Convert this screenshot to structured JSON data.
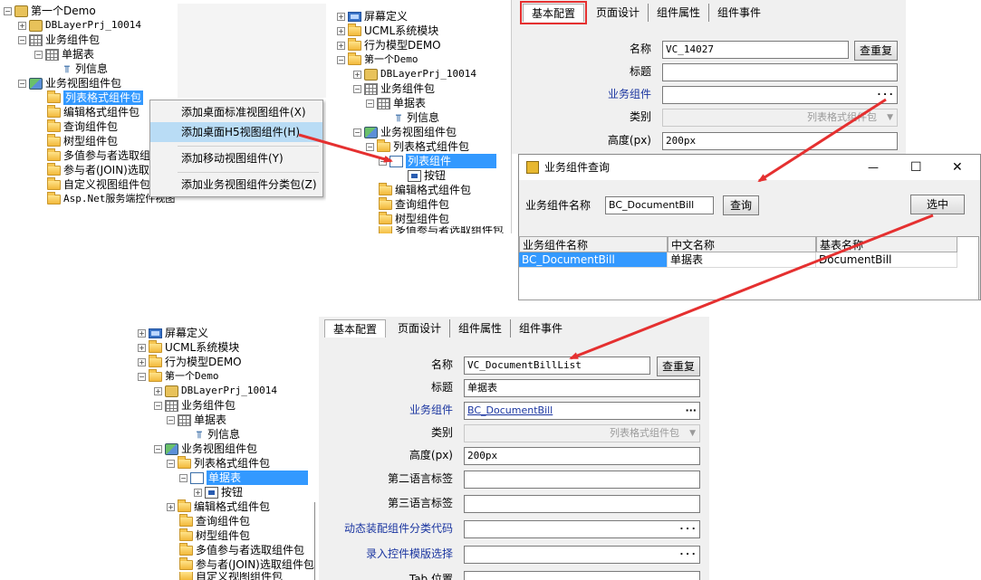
{
  "tree_a": {
    "items": [
      "第一个Demo",
      "DBLayerPrj_10014",
      "业务组件包",
      "单据表",
      "列信息",
      "业务视图组件包",
      "列表格式组件包",
      "编辑格式组件包",
      "查询组件包",
      "树型组件包",
      "多值参与者选取组",
      "参与者(JOIN)选取",
      "自定义视图组件包",
      "Asp.Net服务端控件视图"
    ]
  },
  "context_menu": {
    "items": [
      "添加桌面标准视图组件(X)",
      "添加桌面H5视图组件(H)",
      "添加移动视图组件(Y)",
      "添加业务视图组件分类包(Z)"
    ]
  },
  "tree_b": {
    "items": [
      "屏幕定义",
      "UCML系统模块",
      "行为模型DEMO",
      "第一个Demo",
      "DBLayerPrj_10014",
      "业务组件包",
      "单据表",
      "列信息",
      "业务视图组件包",
      "列表格式组件包",
      "列表组件",
      "按钮",
      "编辑格式组件包",
      "查询组件包",
      "树型组件包",
      "多值参与者选取组件包"
    ]
  },
  "tree_c": {
    "items": [
      "屏幕定义",
      "UCML系统模块",
      "行为模型DEMO",
      "第一个Demo",
      "DBLayerPrj_10014",
      "业务组件包",
      "单据表",
      "列信息",
      "业务视图组件包",
      "列表格式组件包",
      "单据表",
      "按钮",
      "编辑格式组件包",
      "查询组件包",
      "树型组件包",
      "多值参与者选取组件包",
      "参与者(JOIN)选取组件包",
      "自定义视图组件包"
    ]
  },
  "tabs": [
    "基本配置",
    "页面设计",
    "组件属性",
    "组件事件"
  ],
  "form_top": {
    "labels": [
      "名称",
      "标题",
      "业务组件",
      "类别",
      "高度(px)"
    ],
    "name_value": "VC_14027",
    "title_value": "",
    "biz_value": "",
    "category_value": "列表格式组件包",
    "height_value": "200px",
    "check_button": "查重复",
    "dots": "···"
  },
  "dialog": {
    "title": "业务组件查询",
    "search_label": "业务组件名称",
    "search_value": "BC_DocumentBill",
    "query_button": "查询",
    "select_button": "选中",
    "columns": [
      "业务组件名称",
      "中文名称",
      "基表名称"
    ],
    "row": [
      "BC_DocumentBill",
      "单据表",
      "DocumentBill"
    ],
    "min_glyph": "—",
    "max_glyph": "☐",
    "close_glyph": "✕"
  },
  "form_bottom": {
    "labels": [
      "名称",
      "标题",
      "业务组件",
      "类别",
      "高度(px)",
      "第二语言标签",
      "第三语言标签",
      "动态装配组件分类代码",
      "录入控件模版选择",
      "Tab 位置"
    ],
    "name_value": "VC_DocumentBillList",
    "title_value": "单据表",
    "biz_value": "BC_DocumentBill",
    "category_value": "列表格式组件包",
    "height_value": "200px",
    "check_button": "查重复",
    "dots": "···"
  },
  "colors": {
    "selection": "#3399ff",
    "arrow": "#e53030",
    "label_blue": "#1a35a0"
  }
}
